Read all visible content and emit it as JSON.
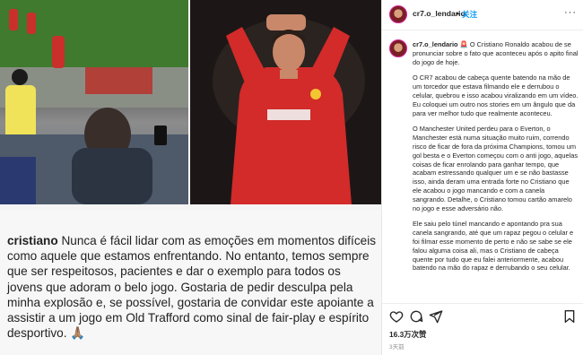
{
  "post": {
    "username": "cr7.o_lendario",
    "separator": "•",
    "follow_label": "关注",
    "more_label": "···"
  },
  "media": {
    "caption_user": "cristiano",
    "caption_body": "Nunca é fácil lidar com as emoções em momentos difíceis como aquele que estamos enfrentando. No entanto, temos sempre que ser respeitosos, pacientes e dar o exemplo para todos os jovens que adoram o belo jogo. Gostaria de pedir desculpa pela minha explosão e, se possível, gostaria de convidar este apoiante a assistir a um jogo em Old Trafford como sinal de fair-play e espírito desportivo. 🙏🏽"
  },
  "comment": {
    "username": "cr7.o_lendario",
    "p1": "🚨 O Cristiano Ronaldo acabou de se pronunciar sobre o fato que aconteceu após o apito final do jogo de hoje.",
    "p2": "O CR7 acabou de cabeça quente batendo na mão de um torcedor que estava filmando ele e derrubou o celular, quebrou e isso acabou viralizando em um vídeo. Eu coloquei um outro nos stories em um ângulo que da para ver melhor tudo que realmente aconteceu.",
    "p3": "O Manchester United perdeu para o Everton, o Manchester está numa situação muito ruim, correndo risco de ficar de fora da próxima Champions, tomou um gol besta e o Everton começou com o anti jogo, aquelas coisas de ficar enrolando para ganhar tempo, que acabam estressando qualquer um e se não bastasse isso, ainda deram uma entrada forte no Cristiano que ele acabou o jogo mancando e com a canela sangrando. Detalhe, o Cristiano tomou cartão amarelo no jogo e esse adversário não.",
    "p4": "Ele saiu pelo túnel mancando e apontando pra sua canela sangrando, até que um rapaz pegou o celular e foi filmar esse momento de perto e não se sabe se ele falou alguma coisa ali, mas o Cristiano de cabeça quente por tudo que eu falei anteriormente, acabou batendo na mão do rapaz e derrubando o seu celular."
  },
  "actions": {
    "likes": "16.3万次赞",
    "time": "3天前"
  },
  "colors": {
    "accent": "#0095f6",
    "text": "#262626",
    "muted": "#8e8e8e"
  },
  "icons": [
    "heart-icon",
    "comment-icon",
    "share-icon",
    "bookmark-icon"
  ]
}
